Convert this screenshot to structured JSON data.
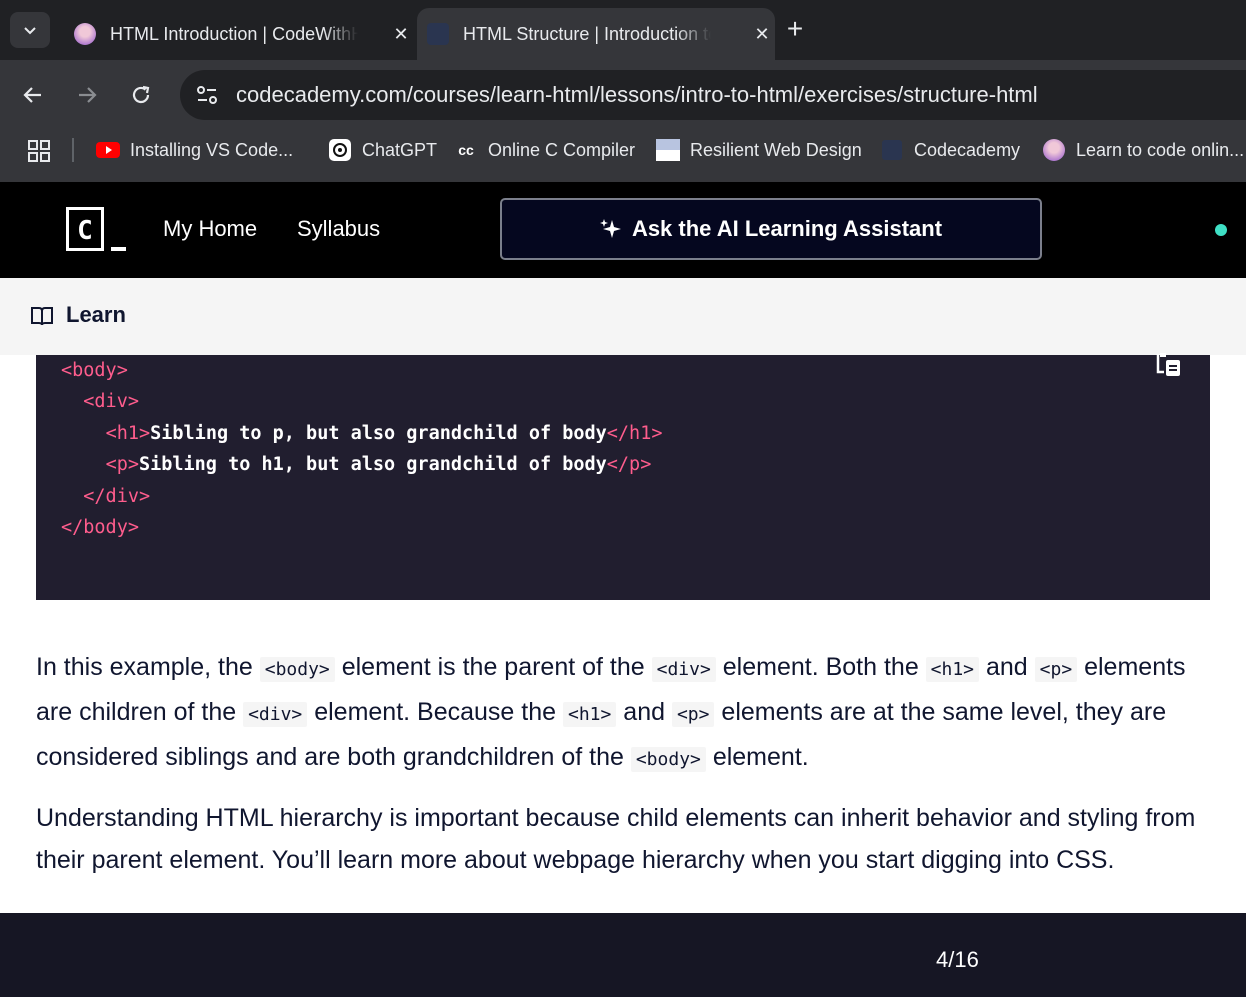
{
  "browser": {
    "tabs": [
      {
        "title": "HTML Introduction | CodeWithHarry",
        "active": false
      },
      {
        "title": "HTML Structure | Introduction to HTML",
        "active": true
      }
    ],
    "url": "codecademy.com/courses/learn-html/lessons/intro-to-html/exercises/structure-html",
    "bookmarks": [
      {
        "label": "Installing VS Code..."
      },
      {
        "label": "ChatGPT"
      },
      {
        "label": "Online C Compiler"
      },
      {
        "label": "Resilient Web Design"
      },
      {
        "label": "Codecademy"
      },
      {
        "label": "Learn to code onlin..."
      }
    ]
  },
  "header": {
    "logo_letter": "C",
    "nav": [
      {
        "label": "My Home"
      },
      {
        "label": "Syllabus"
      }
    ],
    "ai_button": "Ask the AI Learning Assistant"
  },
  "learn_bar": {
    "label": "Learn"
  },
  "code": {
    "lines": [
      {
        "indent": 0,
        "open": "<body>",
        "text": "",
        "close": ""
      },
      {
        "indent": 2,
        "open": "<div>",
        "text": "",
        "close": ""
      },
      {
        "indent": 4,
        "open": "<h1>",
        "text": "Sibling to p, but also grandchild of body",
        "close": "</h1>"
      },
      {
        "indent": 4,
        "open": "<p>",
        "text": "Sibling to h1, but also grandchild of body",
        "close": "</p>"
      },
      {
        "indent": 2,
        "open": "</div>",
        "text": "",
        "close": ""
      },
      {
        "indent": 0,
        "open": "</body>",
        "text": "",
        "close": ""
      }
    ]
  },
  "prose": {
    "p1": [
      {
        "t": "text",
        "v": "In this example, the "
      },
      {
        "t": "code",
        "v": "<body>"
      },
      {
        "t": "text",
        "v": " element is the parent of the "
      },
      {
        "t": "code",
        "v": "<div>"
      },
      {
        "t": "text",
        "v": " element. Both the "
      },
      {
        "t": "code",
        "v": "<h1>"
      },
      {
        "t": "text",
        "v": " and "
      },
      {
        "t": "code",
        "v": "<p>"
      },
      {
        "t": "text",
        "v": " elements are children of the "
      },
      {
        "t": "code",
        "v": "<div>"
      },
      {
        "t": "text",
        "v": " element. Because the "
      },
      {
        "t": "code",
        "v": "<h1>"
      },
      {
        "t": "text",
        "v": " and "
      },
      {
        "t": "code",
        "v": "<p>"
      },
      {
        "t": "text",
        "v": " elements are at the same level, they are considered siblings and are both grandchildren of the "
      },
      {
        "t": "code",
        "v": "<body>"
      },
      {
        "t": "text",
        "v": " element."
      }
    ],
    "p2": "Understanding HTML hierarchy is important because child elements can inherit behavior and styling from their parent element. You’ll learn more about webpage hierarchy when you start digging into CSS."
  },
  "footer": {
    "progress": "4/16"
  },
  "colors": {
    "tag": "#ff5d8d",
    "code_bg": "#211e2f",
    "header_bg": "#000000",
    "accent_dot": "#3fe0c5"
  }
}
